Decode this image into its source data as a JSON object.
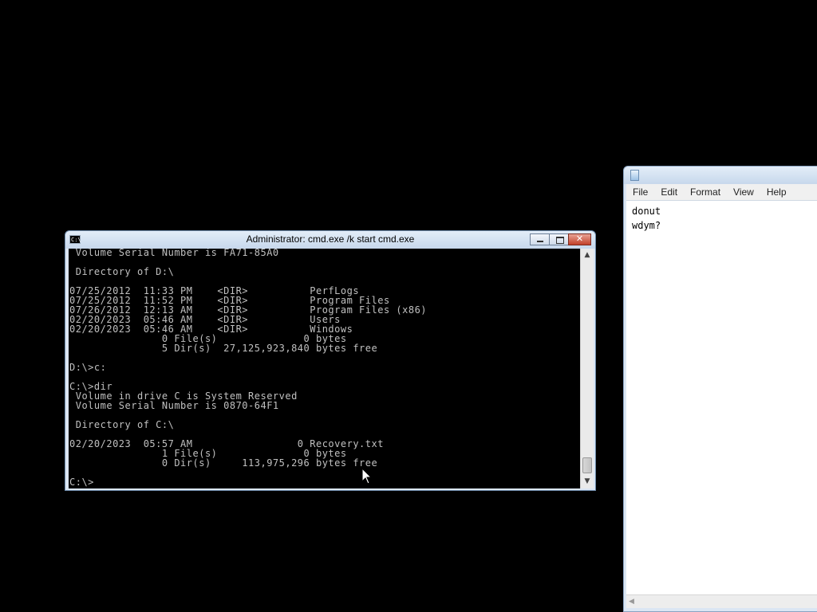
{
  "cmd": {
    "title": "Administrator: cmd.exe /k start cmd.exe",
    "icon_label": "C:\\",
    "lines": [
      " Volume Serial Number is FA71-85A0",
      "",
      " Directory of D:\\",
      "",
      "07/25/2012  11:33 PM    <DIR>          PerfLogs",
      "07/25/2012  11:52 PM    <DIR>          Program Files",
      "07/26/2012  12:13 AM    <DIR>          Program Files (x86)",
      "02/20/2023  05:46 AM    <DIR>          Users",
      "02/20/2023  05:46 AM    <DIR>          Windows",
      "               0 File(s)              0 bytes",
      "               5 Dir(s)  27,125,923,840 bytes free",
      "",
      "D:\\>c:",
      "",
      "C:\\>dir",
      " Volume in drive C is System Reserved",
      " Volume Serial Number is 0870-64F1",
      "",
      " Directory of C:\\",
      "",
      "02/20/2023  05:57 AM                 0 Recovery.txt",
      "               1 File(s)              0 bytes",
      "               0 Dir(s)     113,975,296 bytes free",
      "",
      "C:\\>"
    ]
  },
  "notepad": {
    "menu": [
      "File",
      "Edit",
      "Format",
      "View",
      "Help"
    ],
    "content": "donut\nwdym?"
  },
  "colors": {
    "desktop": "#000000",
    "console_fg": "#c0c0c0",
    "close_button": "#c2402a"
  }
}
